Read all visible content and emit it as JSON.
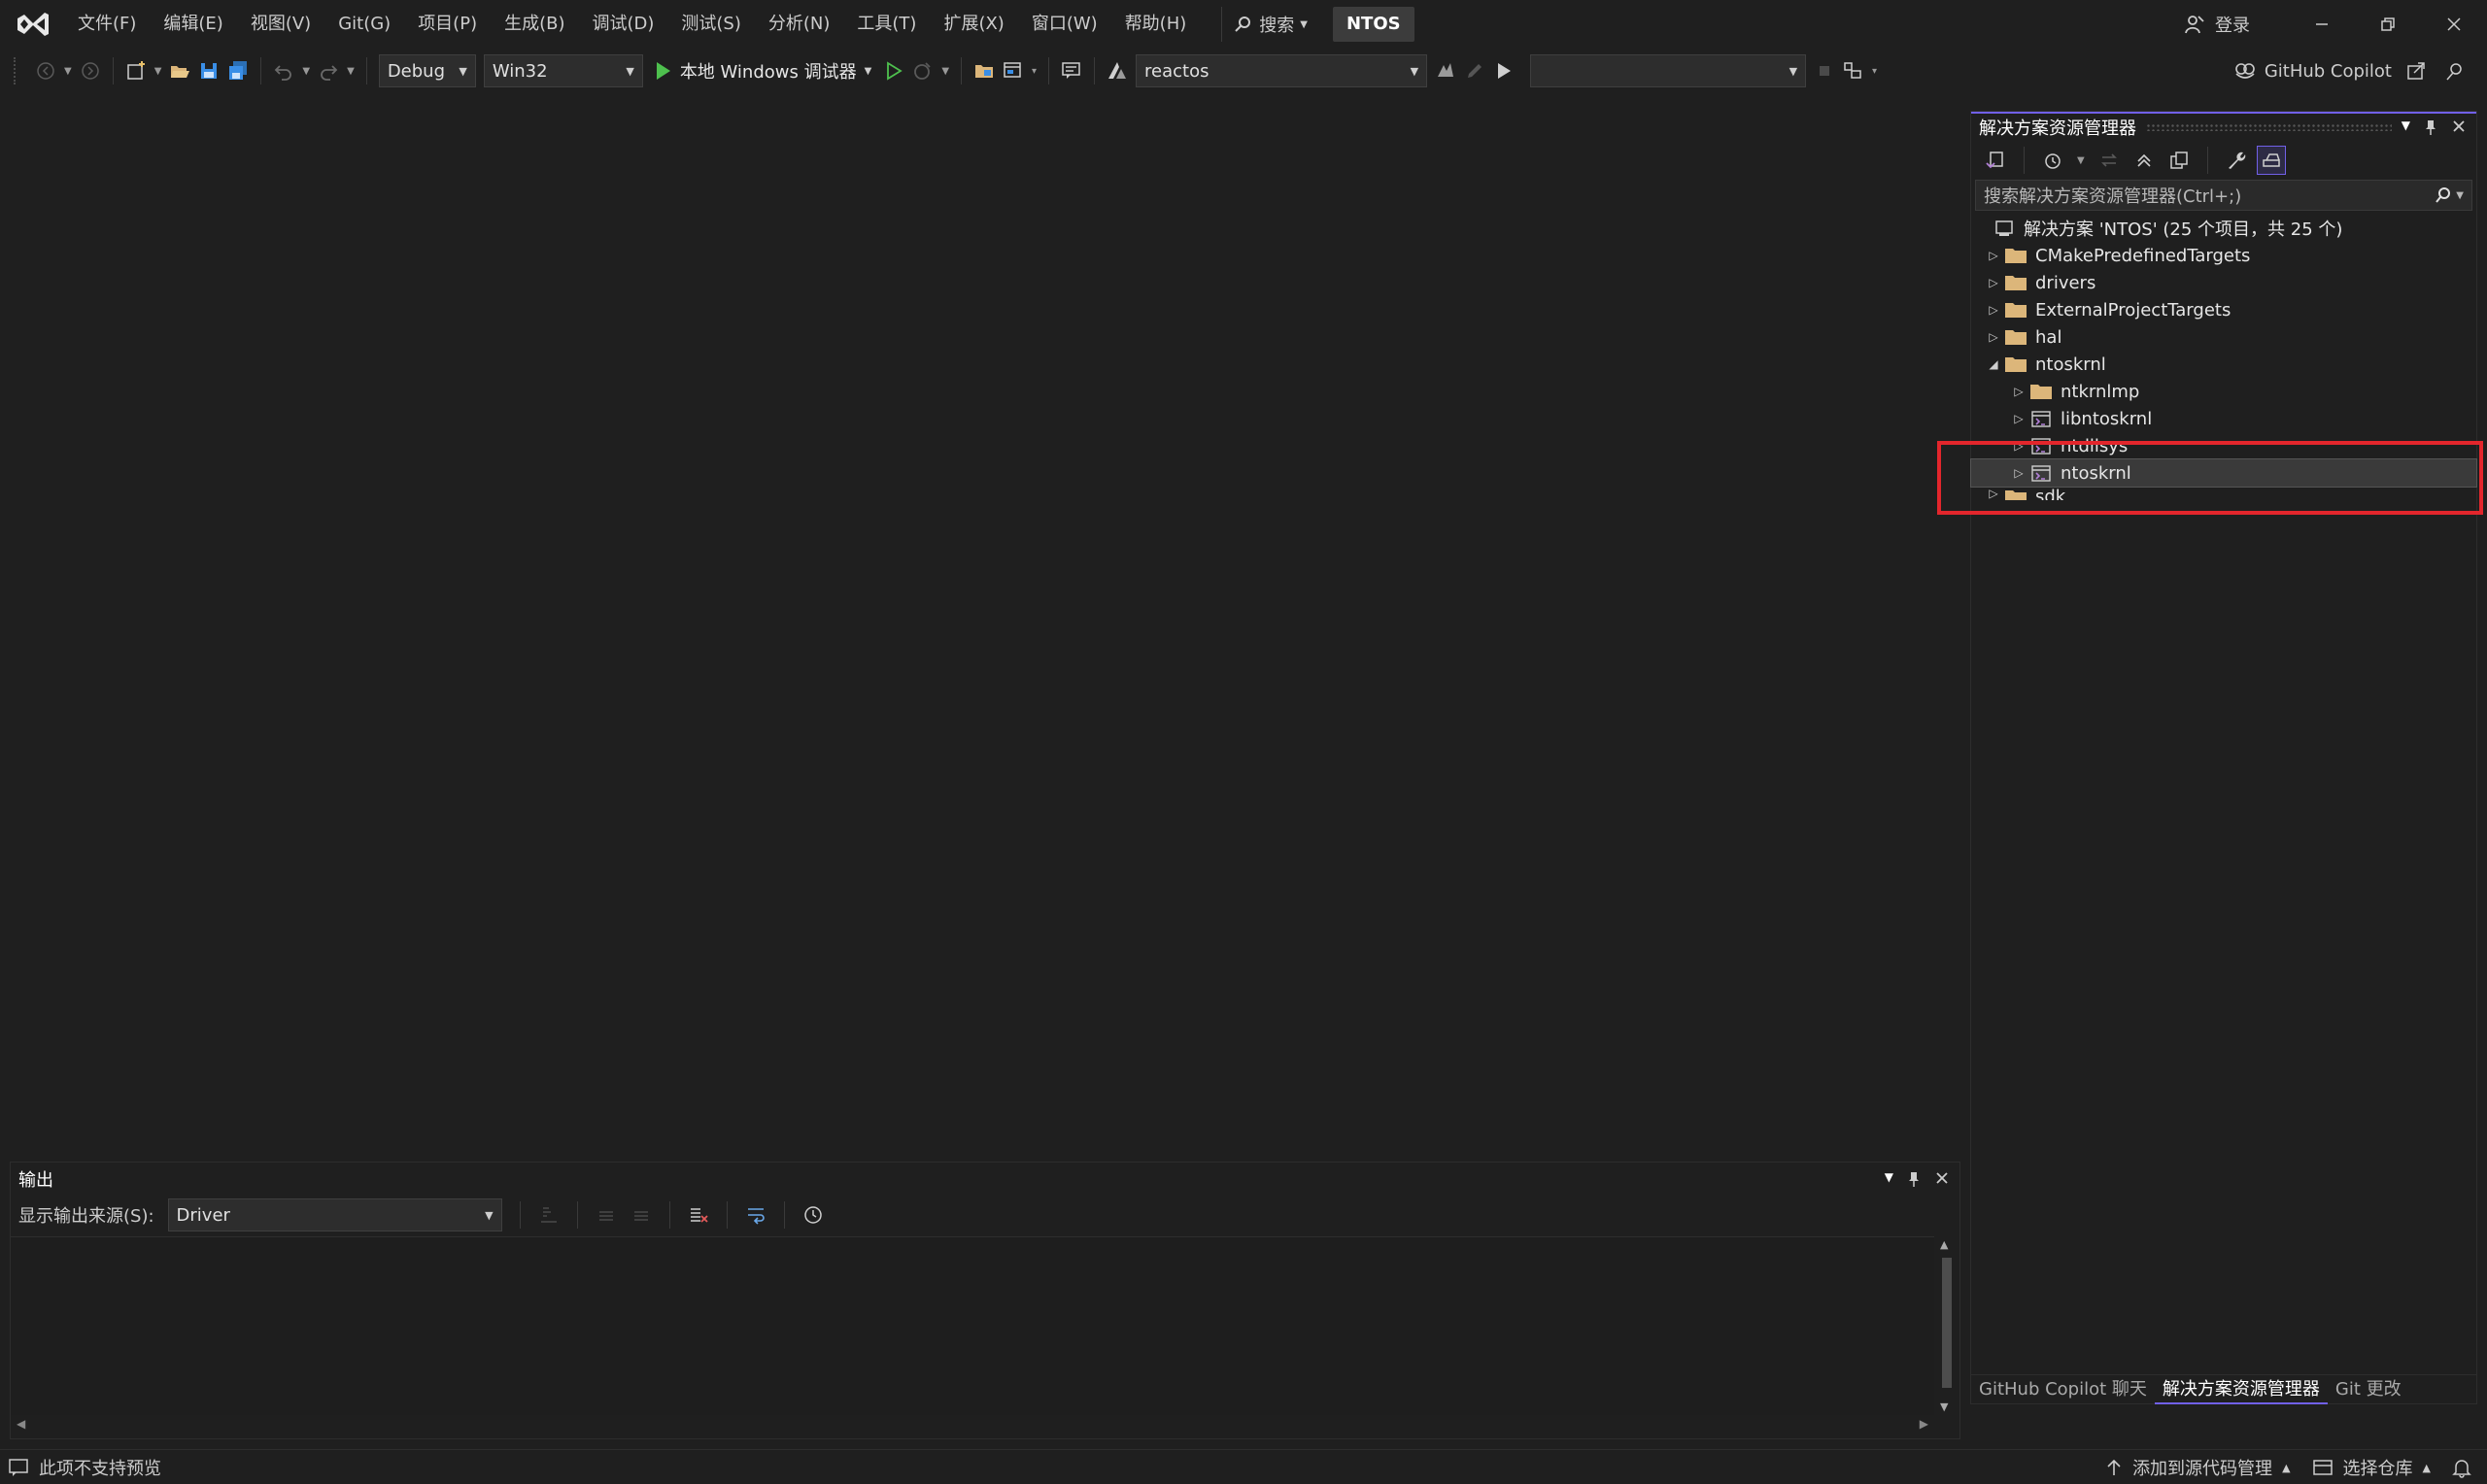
{
  "menu": {
    "items": [
      "文件(F)",
      "编辑(E)",
      "视图(V)",
      "Git(G)",
      "项目(P)",
      "生成(B)",
      "调试(D)",
      "测试(S)",
      "分析(N)",
      "工具(T)",
      "扩展(X)",
      "窗口(W)",
      "帮助(H)"
    ],
    "search_label": "搜索",
    "solution_badge": "NTOS",
    "login_label": "登录"
  },
  "toolbar": {
    "config": "Debug",
    "platform": "Win32",
    "run_label": "本地 Windows 调试器",
    "startup_project": "reactos",
    "empty_combo": "",
    "copilot_label": "GitHub Copilot"
  },
  "solution_explorer": {
    "title": "解决方案资源管理器",
    "search_placeholder": "搜索解决方案资源管理器(Ctrl+;)",
    "solution_root": "解决方案 'NTOS' (25 个项目，共 25 个)",
    "nodes": [
      {
        "label": "CMakePredefinedTargets",
        "level": 1,
        "expand": "collapsed",
        "icon": "folder-icon"
      },
      {
        "label": "drivers",
        "level": 1,
        "expand": "collapsed",
        "icon": "folder-icon"
      },
      {
        "label": "ExternalProjectTargets",
        "level": 1,
        "expand": "collapsed",
        "icon": "folder-icon"
      },
      {
        "label": "hal",
        "level": 1,
        "expand": "collapsed",
        "icon": "folder-icon"
      },
      {
        "label": "ntoskrnl",
        "level": 1,
        "expand": "expanded",
        "icon": "folder-icon"
      },
      {
        "label": "ntkrnlmp",
        "level": 2,
        "expand": "collapsed",
        "icon": "folder-icon"
      },
      {
        "label": "libntoskrnl",
        "level": 2,
        "expand": "collapsed",
        "icon": "project-icon"
      },
      {
        "label": "ntdllsys",
        "level": 2,
        "expand": "collapsed",
        "icon": "project-icon"
      },
      {
        "label": "ntoskrnl",
        "level": 2,
        "expand": "collapsed",
        "icon": "project-icon",
        "selected": true
      },
      {
        "label": "sdk",
        "level": 1,
        "expand": "collapsed",
        "icon": "folder-icon",
        "clipped": true
      }
    ],
    "tabs": [
      "GitHub Copilot 聊天",
      "解决方案资源管理器",
      "Git 更改"
    ],
    "active_tab": 1
  },
  "output": {
    "title": "输出",
    "source_label": "显示输出来源(S):",
    "source_value": "Driver"
  },
  "status": {
    "preview_text": "此项不支持预览",
    "add_source_control": "添加到源代码管理",
    "select_repo": "选择仓库"
  },
  "colors": {
    "accent": "#7160e8",
    "highlight_box": "#e3262c",
    "run_green": "#4ec04e",
    "folder": "#dcb67a",
    "project": "#b180d7"
  }
}
